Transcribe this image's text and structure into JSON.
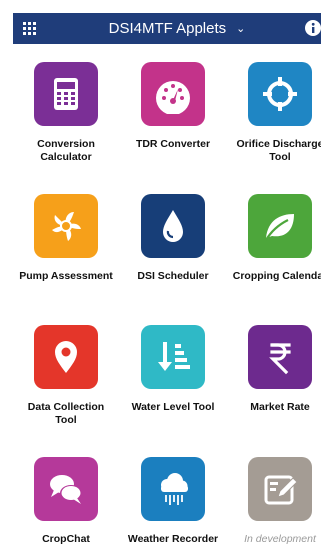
{
  "header": {
    "title": "DSI4MTF Applets",
    "background": "#1f3d7a"
  },
  "applets": [
    {
      "label": "Conversion Calculator",
      "color": "#7b2f96",
      "icon": "calculator-icon"
    },
    {
      "label": "TDR Converter",
      "color": "#c3338a",
      "icon": "gauge-icon"
    },
    {
      "label": "Orifice Discharge Tool",
      "color": "#1f86c4",
      "icon": "crosshair-icon"
    },
    {
      "label": "Pump Assessment",
      "color": "#f6a01a",
      "icon": "fan-icon"
    },
    {
      "label": "DSI Scheduler",
      "color": "#173e78",
      "icon": "water-drop-icon"
    },
    {
      "label": "Cropping Calendar",
      "color": "#4da63b",
      "icon": "leaf-icon"
    },
    {
      "label": "Data Collection Tool",
      "color": "#e4362a",
      "icon": "map-pin-icon"
    },
    {
      "label": "Water Level Tool",
      "color": "#2fb9c6",
      "icon": "sort-down-icon"
    },
    {
      "label": "Market Rate",
      "color": "#6d2a8e",
      "icon": "rupee-icon"
    },
    {
      "label": "CropChat",
      "color": "#b5399a",
      "icon": "chat-bubbles-icon"
    },
    {
      "label": "Weather Recorder",
      "color": "#1b7fbf",
      "icon": "rain-cloud-icon"
    },
    {
      "label": "In development",
      "color": "#a49c94",
      "icon": "edit-icon",
      "disabled": true
    }
  ]
}
